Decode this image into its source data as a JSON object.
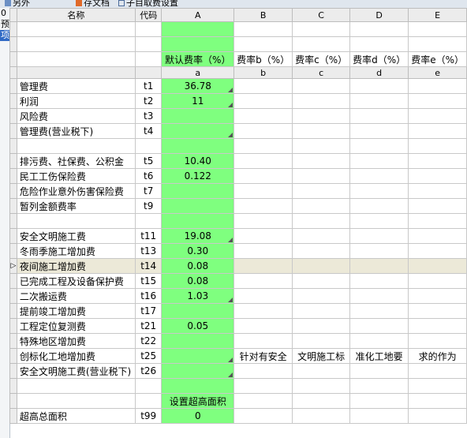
{
  "toolbar": {
    "items": [
      {
        "label": "另外",
        "icon": "document-icon"
      },
      {
        "label": "存文档",
        "icon": "save-icon"
      },
      {
        "label": "子目取费设置",
        "icon": "table-icon"
      }
    ]
  },
  "left_strip": {
    "lines": [
      "0",
      "预",
      "项"
    ]
  },
  "columns": {
    "name": "名称",
    "code": "代码",
    "letters": [
      "A",
      "B",
      "C",
      "D",
      "E"
    ]
  },
  "header_rows": {
    "rate_labels": [
      "默认费率（%）",
      "费率b（%）",
      "费率c（%）",
      "费率d（%）",
      "费率e（%）"
    ],
    "rate_keys": [
      "a",
      "b",
      "c",
      "d",
      "e"
    ]
  },
  "rows": [
    {
      "name": "管理费",
      "code": "t1",
      "a": "36.78",
      "b": "",
      "c": "",
      "d": "",
      "e": "",
      "corner": true
    },
    {
      "name": "利润",
      "code": "t2",
      "a": "11",
      "b": "",
      "c": "",
      "d": "",
      "e": "",
      "corner": true
    },
    {
      "name": "风险费",
      "code": "t3",
      "a": "",
      "b": "",
      "c": "",
      "d": "",
      "e": "",
      "corner": false
    },
    {
      "name": "管理费(营业税下)",
      "code": "t4",
      "a": "",
      "b": "",
      "c": "",
      "d": "",
      "e": "",
      "corner": true
    },
    {
      "name": "",
      "code": "",
      "a": "",
      "b": "",
      "c": "",
      "d": "",
      "e": "",
      "corner": false
    },
    {
      "name": "排污费、社保费、公积金",
      "code": "t5",
      "a": "10.40",
      "b": "",
      "c": "",
      "d": "",
      "e": "",
      "corner": false
    },
    {
      "name": "民工工伤保险费",
      "code": "t6",
      "a": "0.122",
      "b": "",
      "c": "",
      "d": "",
      "e": "",
      "corner": false
    },
    {
      "name": "危险作业意外伤害保险费",
      "code": "t7",
      "a": "",
      "b": "",
      "c": "",
      "d": "",
      "e": "",
      "corner": false
    },
    {
      "name": "暂列金额费率",
      "code": "t9",
      "a": "",
      "b": "",
      "c": "",
      "d": "",
      "e": "",
      "corner": false
    },
    {
      "name": "",
      "code": "",
      "a": "",
      "b": "",
      "c": "",
      "d": "",
      "e": "",
      "corner": false
    },
    {
      "name": "安全文明施工费",
      "code": "t11",
      "a": "19.08",
      "b": "",
      "c": "",
      "d": "",
      "e": "",
      "corner": true
    },
    {
      "name": "冬雨季施工增加费",
      "code": "t13",
      "a": "0.30",
      "b": "",
      "c": "",
      "d": "",
      "e": "",
      "corner": false
    },
    {
      "name": "夜间施工增加费",
      "code": "t14",
      "a": "0.08",
      "b": "",
      "c": "",
      "d": "",
      "e": "",
      "corner": false
    },
    {
      "name": "已完成工程及设备保护费",
      "code": "t15",
      "a": "0.08",
      "b": "",
      "c": "",
      "d": "",
      "e": "",
      "corner": false
    },
    {
      "name": "二次搬运费",
      "code": "t16",
      "a": "1.03",
      "b": "",
      "c": "",
      "d": "",
      "e": "",
      "corner": true
    },
    {
      "name": "提前竣工增加费",
      "code": "t17",
      "a": "",
      "b": "",
      "c": "",
      "d": "",
      "e": "",
      "corner": false
    },
    {
      "name": "工程定位复测费",
      "code": "t21",
      "a": "0.05",
      "b": "",
      "c": "",
      "d": "",
      "e": "",
      "corner": false
    },
    {
      "name": "特殊地区增加费",
      "code": "t22",
      "a": "",
      "b": "",
      "c": "",
      "d": "",
      "e": "",
      "corner": false
    },
    {
      "name": "创标化工地增加费",
      "code": "t25",
      "a": "",
      "b": "针对有安全",
      "c": "文明施工标",
      "d": "准化工地要",
      "e": "求的作为",
      "corner": true
    },
    {
      "name": "安全文明施工费(营业税下)",
      "code": "t26",
      "a": "",
      "b": "",
      "c": "",
      "d": "",
      "e": "",
      "corner": true
    },
    {
      "name": "",
      "code": "",
      "a": "",
      "b": "",
      "c": "",
      "d": "",
      "e": "",
      "corner": false
    },
    {
      "name": "",
      "code": "",
      "a": "设置超高面积",
      "b": "",
      "c": "",
      "d": "",
      "e": "",
      "corner": false
    },
    {
      "name": "超高总面积",
      "code": "t99",
      "a": "0",
      "b": "",
      "c": "",
      "d": "",
      "e": "",
      "corner": false
    }
  ],
  "current_row_index": 12,
  "current_row_marker": "▷",
  "colors": {
    "rate_column": "#7fff7f",
    "current_row": "#ece9d8"
  }
}
